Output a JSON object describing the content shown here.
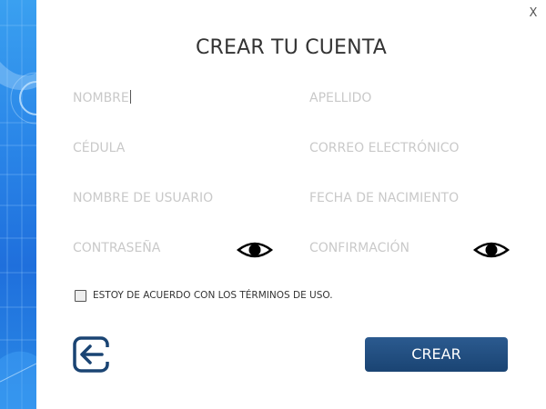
{
  "window": {
    "close_label": "X"
  },
  "form": {
    "title": "CREAR TU CUENTA",
    "fields": {
      "nombre": "NOMBRE",
      "apellido": "APELLIDO",
      "cedula": "CÉDULA",
      "correo": "CORREO ELECTRÓNICO",
      "usuario": "NOMBRE DE USUARIO",
      "nacimiento": "FECHA DE NACIMIENTO",
      "contrasena": "CONTRASEÑA",
      "confirmacion": "CONFIRMACIÓN"
    },
    "terms_label": "ESTOY DE ACUERDO CON LOS TÉRMINOS DE USO.",
    "terms_checked": false,
    "create_label": "CREAR"
  },
  "icons": {
    "close": "close-icon",
    "eye": "eye-icon",
    "back": "back-arrow-icon"
  },
  "colors": {
    "accent": "#1a4473",
    "side_panel": "#2a86e8",
    "placeholder": "#c9c9c9",
    "title": "#333333"
  }
}
